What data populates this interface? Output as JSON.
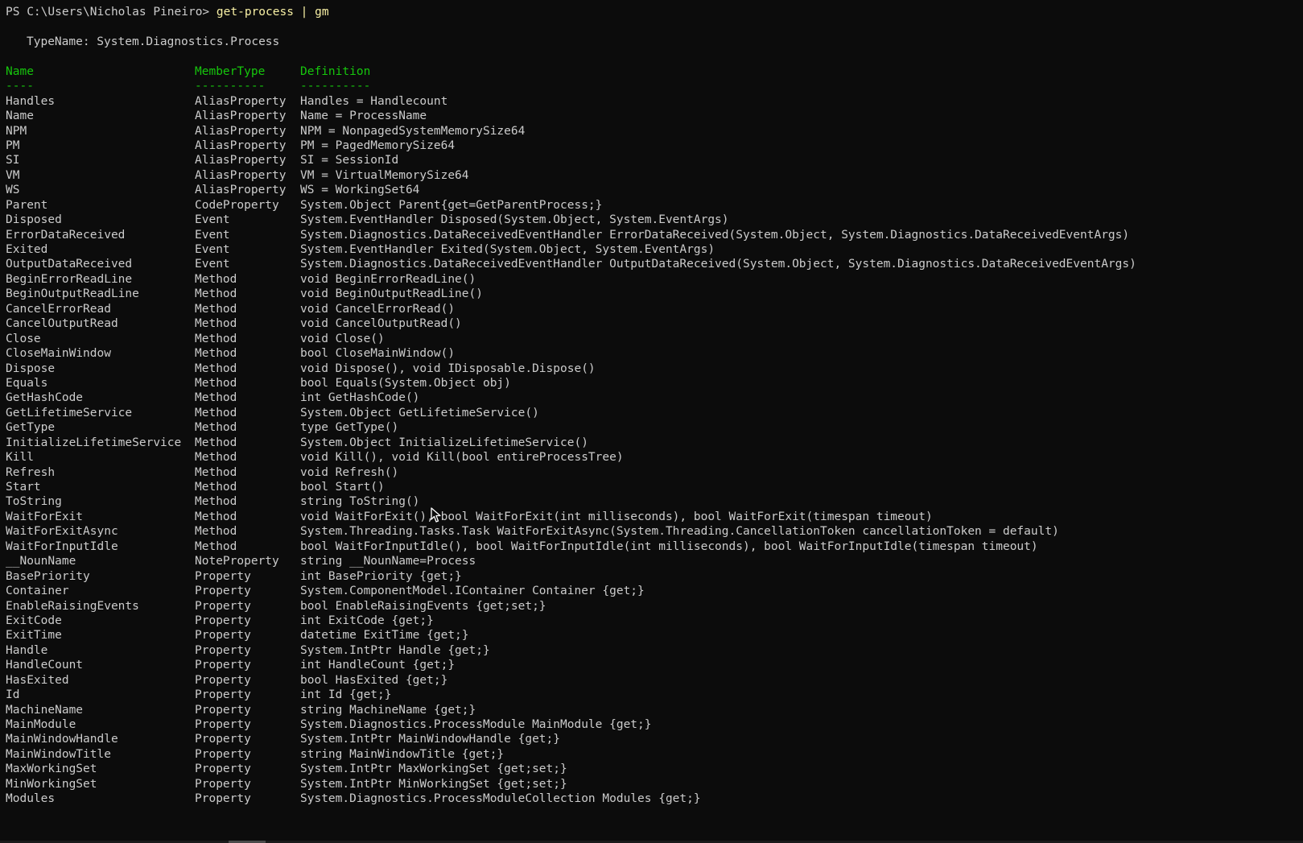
{
  "prompt": {
    "path": "PS C:\\Users\\Nicholas Pineiro> ",
    "command": "get-process | gm"
  },
  "typename_line": "TypeName: System.Diagnostics.Process",
  "headers": {
    "name": "Name",
    "membertype": "MemberType",
    "definition": "Definition",
    "name_sep": "----",
    "membertype_sep": "----------",
    "definition_sep": "----------"
  },
  "colors": {
    "background": "#0c0c0c",
    "text": "#cccccc",
    "command": "#f9f1a5",
    "header": "#16c60c"
  },
  "rows": [
    {
      "name": "Handles",
      "type": "AliasProperty",
      "def": "Handles = Handlecount"
    },
    {
      "name": "Name",
      "type": "AliasProperty",
      "def": "Name = ProcessName"
    },
    {
      "name": "NPM",
      "type": "AliasProperty",
      "def": "NPM = NonpagedSystemMemorySize64"
    },
    {
      "name": "PM",
      "type": "AliasProperty",
      "def": "PM = PagedMemorySize64"
    },
    {
      "name": "SI",
      "type": "AliasProperty",
      "def": "SI = SessionId"
    },
    {
      "name": "VM",
      "type": "AliasProperty",
      "def": "VM = VirtualMemorySize64"
    },
    {
      "name": "WS",
      "type": "AliasProperty",
      "def": "WS = WorkingSet64"
    },
    {
      "name": "Parent",
      "type": "CodeProperty",
      "def": "System.Object Parent{get=GetParentProcess;}"
    },
    {
      "name": "Disposed",
      "type": "Event",
      "def": "System.EventHandler Disposed(System.Object, System.EventArgs)"
    },
    {
      "name": "ErrorDataReceived",
      "type": "Event",
      "def": "System.Diagnostics.DataReceivedEventHandler ErrorDataReceived(System.Object, System.Diagnostics.DataReceivedEventArgs)"
    },
    {
      "name": "Exited",
      "type": "Event",
      "def": "System.EventHandler Exited(System.Object, System.EventArgs)"
    },
    {
      "name": "OutputDataReceived",
      "type": "Event",
      "def": "System.Diagnostics.DataReceivedEventHandler OutputDataReceived(System.Object, System.Diagnostics.DataReceivedEventArgs)"
    },
    {
      "name": "BeginErrorReadLine",
      "type": "Method",
      "def": "void BeginErrorReadLine()"
    },
    {
      "name": "BeginOutputReadLine",
      "type": "Method",
      "def": "void BeginOutputReadLine()"
    },
    {
      "name": "CancelErrorRead",
      "type": "Method",
      "def": "void CancelErrorRead()"
    },
    {
      "name": "CancelOutputRead",
      "type": "Method",
      "def": "void CancelOutputRead()"
    },
    {
      "name": "Close",
      "type": "Method",
      "def": "void Close()"
    },
    {
      "name": "CloseMainWindow",
      "type": "Method",
      "def": "bool CloseMainWindow()"
    },
    {
      "name": "Dispose",
      "type": "Method",
      "def": "void Dispose(), void IDisposable.Dispose()"
    },
    {
      "name": "Equals",
      "type": "Method",
      "def": "bool Equals(System.Object obj)"
    },
    {
      "name": "GetHashCode",
      "type": "Method",
      "def": "int GetHashCode()"
    },
    {
      "name": "GetLifetimeService",
      "type": "Method",
      "def": "System.Object GetLifetimeService()"
    },
    {
      "name": "GetType",
      "type": "Method",
      "def": "type GetType()"
    },
    {
      "name": "InitializeLifetimeService",
      "type": "Method",
      "def": "System.Object InitializeLifetimeService()"
    },
    {
      "name": "Kill",
      "type": "Method",
      "def": "void Kill(), void Kill(bool entireProcessTree)"
    },
    {
      "name": "Refresh",
      "type": "Method",
      "def": "void Refresh()"
    },
    {
      "name": "Start",
      "type": "Method",
      "def": "bool Start()"
    },
    {
      "name": "ToString",
      "type": "Method",
      "def": "string ToString()"
    },
    {
      "name": "WaitForExit",
      "type": "Method",
      "def": "void WaitForExit(), bool WaitForExit(int milliseconds), bool WaitForExit(timespan timeout)"
    },
    {
      "name": "WaitForExitAsync",
      "type": "Method",
      "def": "System.Threading.Tasks.Task WaitForExitAsync(System.Threading.CancellationToken cancellationToken = default)"
    },
    {
      "name": "WaitForInputIdle",
      "type": "Method",
      "def": "bool WaitForInputIdle(), bool WaitForInputIdle(int milliseconds), bool WaitForInputIdle(timespan timeout)"
    },
    {
      "name": "__NounName",
      "type": "NoteProperty",
      "def": "string __NounName=Process"
    },
    {
      "name": "BasePriority",
      "type": "Property",
      "def": "int BasePriority {get;}"
    },
    {
      "name": "Container",
      "type": "Property",
      "def": "System.ComponentModel.IContainer Container {get;}"
    },
    {
      "name": "EnableRaisingEvents",
      "type": "Property",
      "def": "bool EnableRaisingEvents {get;set;}"
    },
    {
      "name": "ExitCode",
      "type": "Property",
      "def": "int ExitCode {get;}"
    },
    {
      "name": "ExitTime",
      "type": "Property",
      "def": "datetime ExitTime {get;}"
    },
    {
      "name": "Handle",
      "type": "Property",
      "def": "System.IntPtr Handle {get;}"
    },
    {
      "name": "HandleCount",
      "type": "Property",
      "def": "int HandleCount {get;}"
    },
    {
      "name": "HasExited",
      "type": "Property",
      "def": "bool HasExited {get;}"
    },
    {
      "name": "Id",
      "type": "Property",
      "def": "int Id {get;}"
    },
    {
      "name": "MachineName",
      "type": "Property",
      "def": "string MachineName {get;}"
    },
    {
      "name": "MainModule",
      "type": "Property",
      "def": "System.Diagnostics.ProcessModule MainModule {get;}"
    },
    {
      "name": "MainWindowHandle",
      "type": "Property",
      "def": "System.IntPtr MainWindowHandle {get;}"
    },
    {
      "name": "MainWindowTitle",
      "type": "Property",
      "def": "string MainWindowTitle {get;}"
    },
    {
      "name": "MaxWorkingSet",
      "type": "Property",
      "def": "System.IntPtr MaxWorkingSet {get;set;}"
    },
    {
      "name": "MinWorkingSet",
      "type": "Property",
      "def": "System.IntPtr MinWorkingSet {get;set;}"
    },
    {
      "name": "Modules",
      "type": "Property",
      "def": "System.Diagnostics.ProcessModuleCollection Modules {get;}"
    }
  ]
}
